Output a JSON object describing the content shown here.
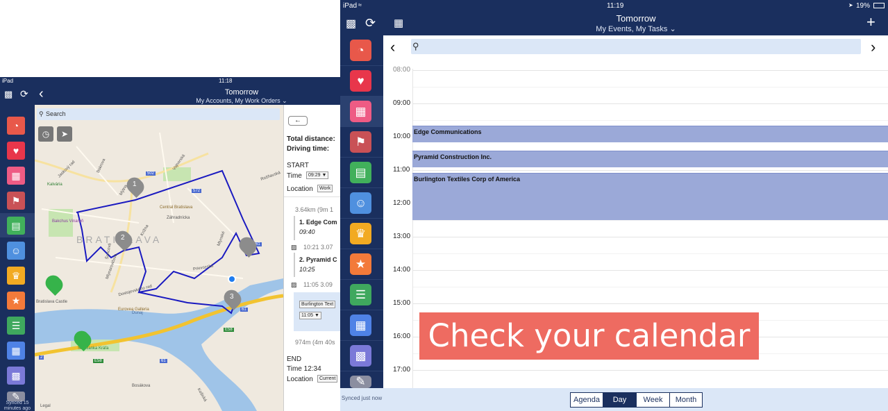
{
  "back": {
    "status": {
      "left": "iPad",
      "time": "11:18"
    },
    "header": {
      "title": "Tomorrow",
      "subtitle": "My Accounts, My Work Orders"
    },
    "search_placeholder": "Search",
    "sidebar_synced": "Synced 15 minutes ago",
    "map_labels": {
      "area": "BRATISLAVA",
      "central": "Central Bratislava",
      "bakchus": "Bakchus Vinareň",
      "kalvaria": "Kalvária",
      "castle": "Bratislava Castle",
      "sad": "Sad Janka Kráľa",
      "dunaj": "Dunaj",
      "eurovea": "Eurovea Galleria",
      "legal": "Legal",
      "pins": [
        "1",
        "2",
        "3"
      ],
      "roads": [
        "502",
        "572",
        "61",
        "61",
        "E58",
        "E58",
        "61",
        "2"
      ],
      "streets": [
        "Jaskový rad",
        "Bokrova",
        "Mýtna",
        "Vajnorská",
        "Záhradnícka",
        "Krížna",
        "Šancová",
        "Rožňavská",
        "Mlynské",
        "Prievozská",
        "Bosákova",
        "Dostojevského rad",
        "Mlynarovičova",
        "Košická"
      ]
    },
    "route": {
      "total_distance": "Total distance:",
      "driving_time": "Driving time:",
      "start": "START",
      "time_label": "Time",
      "time_value": "09:29",
      "location_label": "Location",
      "location_value": "Work",
      "leg1": "3.64km (9m 1",
      "stop1_name": "1. Edge Com",
      "stop1_time": "09:40",
      "leg2": "10:21  3.07",
      "stop2_name": "2. Pyramid C",
      "stop2_time": "10:25",
      "leg3": "11:05  3.09",
      "stop3_select": "Burlington Text",
      "stop3_time": "11:05",
      "leg4": "974m (4m 40s",
      "end": "END",
      "end_time": "Time 12:34",
      "end_location_label": "Location",
      "end_location_value": "Current"
    }
  },
  "front": {
    "status": {
      "left": "iPad",
      "time": "11:19",
      "battery": "19%"
    },
    "header": {
      "title": "Tomorrow",
      "subtitle": "My Events, My Tasks"
    },
    "sidebar_synced": "Synced just now",
    "hours": [
      "08:00",
      "09:00",
      "10:00",
      "11:00",
      "12:00",
      "13:00",
      "14:00",
      "15:00",
      "16:00",
      "17:00"
    ],
    "events": [
      {
        "title": "Edge Communications"
      },
      {
        "title": "Pyramid Construction Inc."
      },
      {
        "title": "Burlington Textiles Corp of America"
      }
    ],
    "view_tabs": [
      "Agenda",
      "Day",
      "Week",
      "Month"
    ],
    "selected_tab": "Day"
  },
  "banner": "Check your calendar",
  "colors": {
    "navy": "#1a2f5e",
    "event_fill": "#9ba9d8",
    "banner": "#ee6b61",
    "search_bg": "#dbe7f7",
    "route_line": "#1a1ac0",
    "motorway": "#f2c330",
    "river": "#9fc4e8",
    "park": "#c7e5b1"
  },
  "sidebar_icons": [
    "dashboard-icon",
    "heart-icon",
    "calendar-icon",
    "map-icon",
    "route-icon",
    "contacts-icon",
    "crown-icon",
    "star-icon",
    "tasks-icon",
    "buildings-icon",
    "card-icon",
    "notes-icon"
  ]
}
